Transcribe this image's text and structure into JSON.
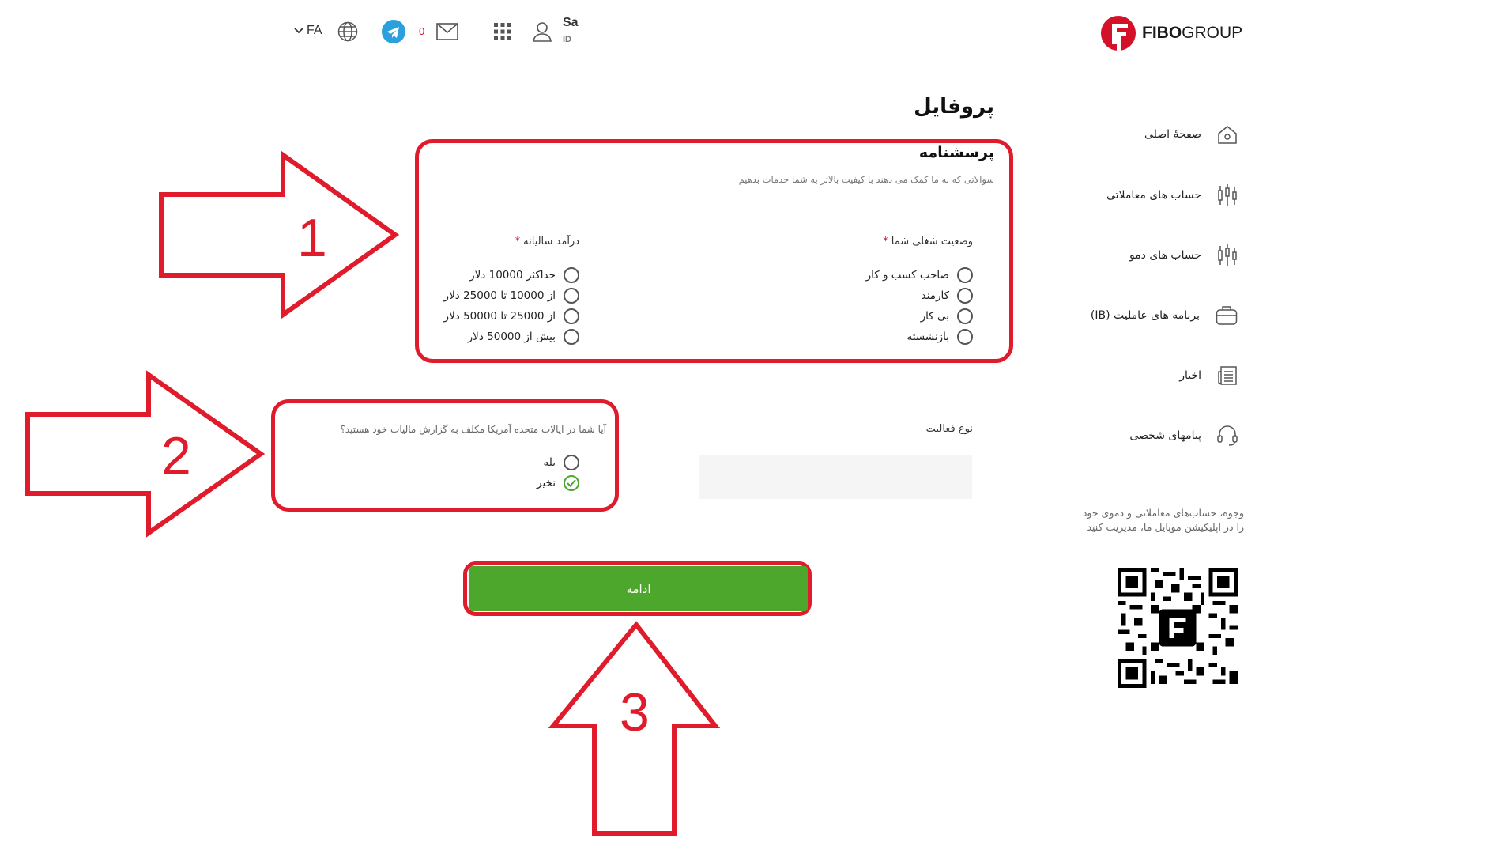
{
  "header": {
    "logo": {
      "bold": "FIBO",
      "regular": "GROUP"
    },
    "user_name": "Sa",
    "user_id_label": "ID",
    "language": "FA",
    "message_count": "0",
    "icons": [
      "logo-icon",
      "user-icon",
      "apps-grid-icon",
      "mail-icon",
      "telegram-icon",
      "globe-icon",
      "chevron-down-icon"
    ]
  },
  "sidebar": {
    "items": [
      {
        "label": "صفحهٔ اصلی",
        "icon": "home-icon"
      },
      {
        "label": "حساب های معاملاتی",
        "icon": "candlestick-icon"
      },
      {
        "label": "حساب های دمو",
        "icon": "candlestick-icon"
      },
      {
        "label": "برنامه های عاملیت (IB)",
        "icon": "briefcase-icon"
      },
      {
        "label": "اخبار",
        "icon": "news-icon"
      },
      {
        "label": "پیامهای شخصی",
        "icon": "headset-icon"
      }
    ],
    "promo_text": "وجوه، حساب‌های معاملاتی و دموی خود را در اپلیکیشن موبایل ما، مدیریت کنید"
  },
  "page": {
    "title": "پروفایل",
    "questionnaire_title": "پرسشنامه",
    "questionnaire_subtitle": "سوالاتی که به ما کمک می دهند با کیفیت بالاتر به شما خدمات بدهیم",
    "employment": {
      "label": "وضعیت شغلی شما",
      "required_mark": "*",
      "options": [
        "صاحب کسب و کار",
        "کارمند",
        "بی کار",
        "بازنشسته"
      ]
    },
    "income": {
      "label": "درآمد سالیانه",
      "required_mark": "*",
      "options": [
        "حداکثر 10000 دلار",
        "از 10000 تا 25000 دلار",
        "از 25000 تا 50000 دلار",
        "بیش از 50000 دلار"
      ]
    },
    "activity": {
      "label": "نوع فعالیت",
      "value": ""
    },
    "us_tax": {
      "question": "آیا شما در ایالات متحده آمریکا مکلف به گزارش مالیات خود هستید؟",
      "options": [
        "بله",
        "نخیر"
      ],
      "selected": "نخیر"
    },
    "continue_label": "ادامه"
  },
  "annotations": {
    "numbers": [
      "1",
      "2",
      "3"
    ],
    "color": "#e01b2b"
  },
  "colors": {
    "brand_red": "#d3122a",
    "button_green": "#4ca72c",
    "annotation_red": "#e01b2b"
  }
}
